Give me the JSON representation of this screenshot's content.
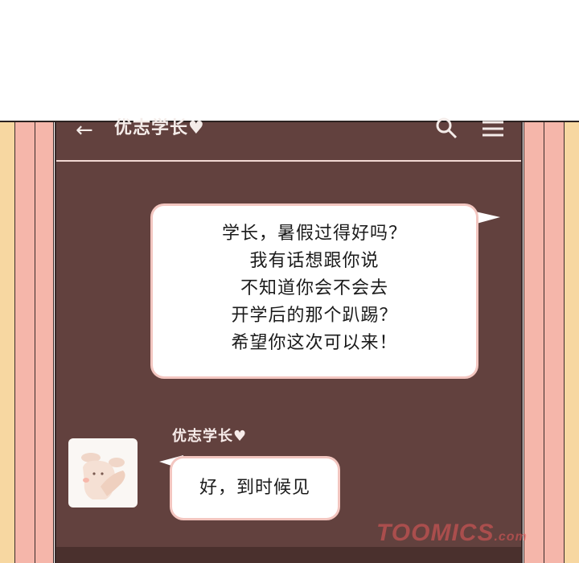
{
  "header": {
    "back_icon": "←",
    "title": "优志学长♥",
    "search_icon": "search-icon",
    "menu_icon": "menu-icon"
  },
  "messages": {
    "sent": {
      "lines": [
        "学长，暑假过得好吗？",
        "我有话想跟你说",
        "不知道你会不会去",
        "开学后的那个趴踢？",
        "希望你这次可以来！"
      ]
    },
    "received": {
      "sender": "优志学长♥",
      "text": "好，到时候见"
    }
  },
  "watermark": {
    "brand": "TOOMICS",
    "domain": ".com"
  },
  "colors": {
    "chat_bg": "#62413e",
    "bubble_border": "#f3c6c0",
    "stripe_pink": "#f5b6aa",
    "stripe_yellow": "#f7d7a1"
  }
}
